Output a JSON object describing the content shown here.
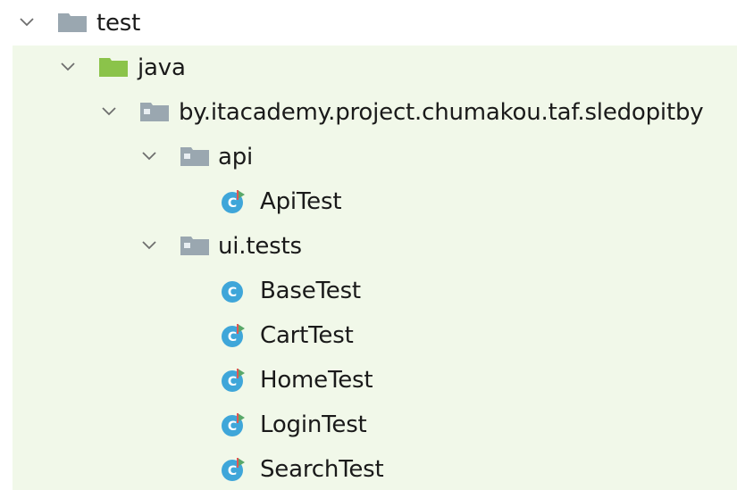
{
  "tree": {
    "root": {
      "label": "test",
      "icon": "folder-icon",
      "expanded": true
    },
    "java": {
      "label": "java",
      "icon": "source-folder-icon",
      "expanded": true
    },
    "package": {
      "label": "by.itacademy.project.chumakou.taf.sledopitby",
      "icon": "package-icon",
      "expanded": true
    },
    "api": {
      "label": "api",
      "icon": "package-icon",
      "expanded": true
    },
    "api_items": [
      {
        "label": "ApiTest",
        "icon": "test-class-icon"
      }
    ],
    "ui": {
      "label": "ui.tests",
      "icon": "package-icon",
      "expanded": true
    },
    "ui_items": [
      {
        "label": "BaseTest",
        "icon": "class-icon"
      },
      {
        "label": "CartTest",
        "icon": "test-class-icon"
      },
      {
        "label": "HomeTest",
        "icon": "test-class-icon"
      },
      {
        "label": "LoginTest",
        "icon": "test-class-icon"
      },
      {
        "label": "SearchTest",
        "icon": "test-class-icon"
      }
    ]
  },
  "colors": {
    "row_highlight": "#f1f8e9",
    "folder_gray": "#9aa7b0",
    "source_folder_green": "#8bc34a",
    "class_blue": "#3fa6d9",
    "test_marker_green": "#59a869",
    "test_marker_red": "#e05555"
  }
}
